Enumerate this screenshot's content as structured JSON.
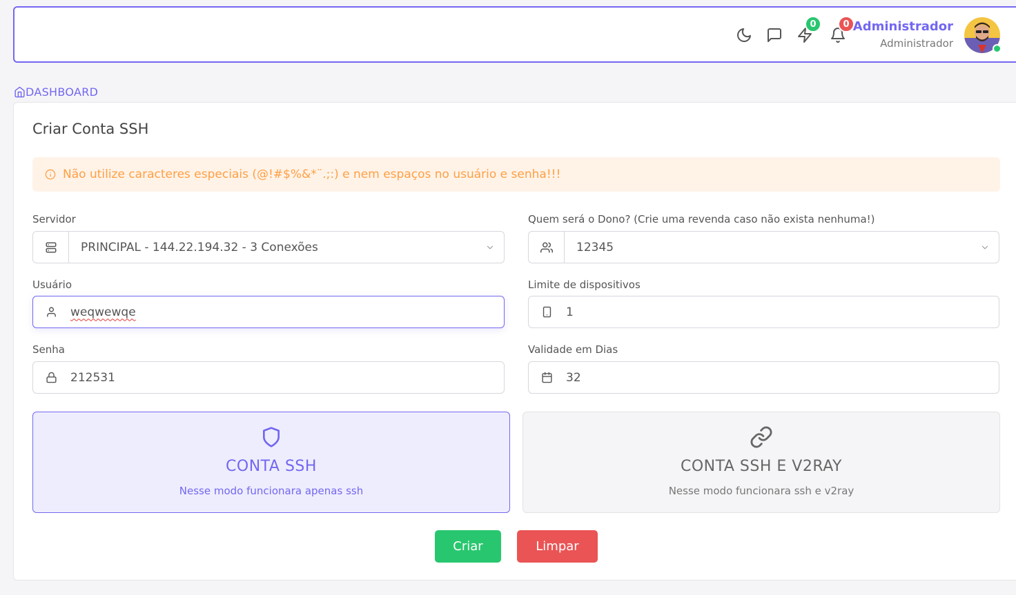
{
  "header": {
    "notifications": [
      {
        "name": "moon-icon"
      },
      {
        "name": "chat-icon"
      },
      {
        "name": "bolt-icon",
        "count": "0",
        "badge_color": "#28c76f"
      },
      {
        "name": "bell-icon",
        "count": "0",
        "badge_color": "#ea5455"
      }
    ],
    "bolt_count": "0",
    "bell_count": "0",
    "user_name": "Administrador",
    "user_role": "Administrador",
    "accent": "#7367f0"
  },
  "breadcrumb": {
    "label": "DASHBOARD"
  },
  "card": {
    "title": "Criar Conta SSH"
  },
  "alert": {
    "text": "Não utilize caracteres especiais (@!#$%&*¨.;:) e nem espaços no usuário e senha!!!",
    "color": "#ff9f43"
  },
  "form": {
    "servidor_label": "Servidor",
    "servidor_value": "PRINCIPAL - 144.22.194.32 - 3 Conexões",
    "dono_label": "Quem será o Dono? (Crie uma revenda caso não exista nenhuma!)",
    "dono_value": "12345",
    "usuario_label": "Usuário",
    "usuario_value": "weqwewqe",
    "limite_label": "Limite de dispositivos",
    "limite_value": "1",
    "senha_label": "Senha",
    "senha_value": "212531",
    "validade_label": "Validade em Dias",
    "validade_value": "32"
  },
  "modes": {
    "ssh_title": "CONTA SSH",
    "ssh_desc": "Nesse modo funcionara apenas ssh",
    "v2ray_title": "CONTA SSH E V2RAY",
    "v2ray_desc": "Nesse modo funcionara ssh e v2ray"
  },
  "buttons": {
    "criar": "Criar",
    "limpar": "Limpar",
    "criar_color": "#28c76f",
    "limpar_color": "#ea5455"
  }
}
